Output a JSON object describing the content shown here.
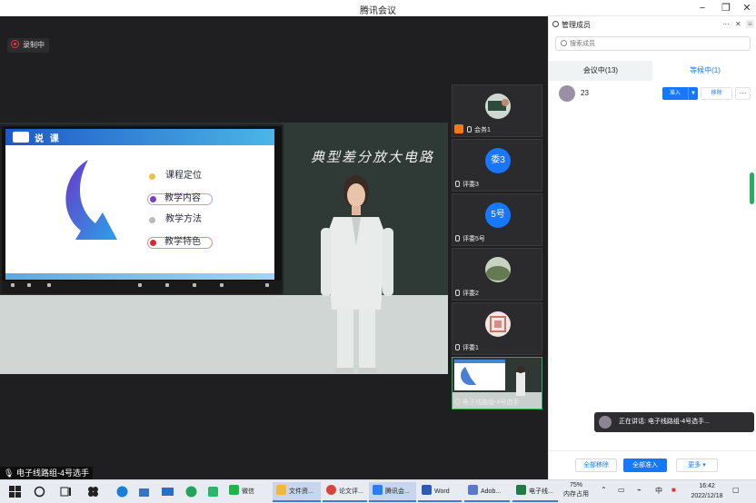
{
  "window": {
    "title": "腾讯会议"
  },
  "recording": {
    "label": "录制中"
  },
  "stage": {
    "blackboard_text": "典型差分放大电路",
    "slide": {
      "header_title": "说 课",
      "items": [
        "课程定位",
        "教学内容",
        "教学方法",
        "教学特色"
      ]
    },
    "caption": "电子线路组-4号选手"
  },
  "thumbnails": [
    {
      "name": "会务1",
      "avatar_text": ""
    },
    {
      "name": "评委3",
      "avatar_text": "委3"
    },
    {
      "name": "评委5号",
      "avatar_text": "5号"
    },
    {
      "name": "评委2",
      "avatar_text": ""
    },
    {
      "name": "评委1",
      "avatar_text": ""
    },
    {
      "name": "电子线路组-4号选手",
      "avatar_text": ""
    }
  ],
  "panel": {
    "title": "管理成员",
    "search_placeholder": "搜索成员",
    "tabs": [
      "会议中(13)",
      "等候中(1)"
    ],
    "member": {
      "name": "23",
      "admit_label": "准入",
      "remove_label": "移除",
      "more_label": "···"
    },
    "toast": "正在讲话: 电子线路组-4号选手...",
    "footer": {
      "remove_all": "全部移除",
      "admit_all": "全部准入",
      "more": "更多"
    }
  },
  "taskbar": {
    "apps": [
      "微信",
      "文件资...",
      "论文评...",
      "腾讯会...",
      "Word",
      "Adob...",
      "电子线..."
    ],
    "memory_pct": "75%",
    "memory_label": "内存占用",
    "ime": "中",
    "time": "16:42",
    "date": "2022/12/18"
  },
  "colors": {
    "accent": "#1677ff",
    "active_speaker": "#1cb35a"
  }
}
